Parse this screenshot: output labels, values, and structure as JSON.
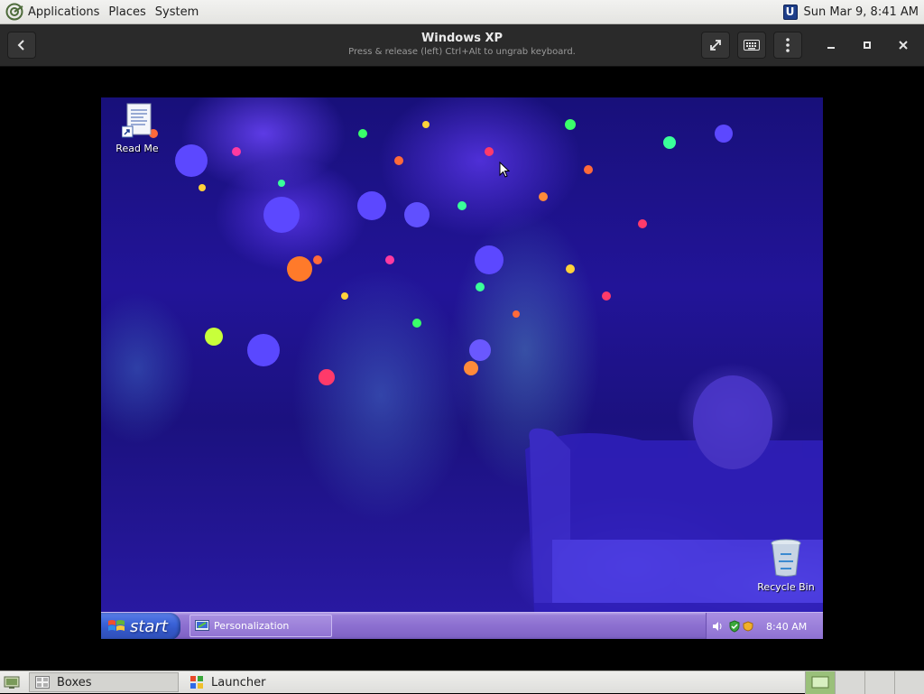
{
  "top_panel": {
    "menus": [
      "Applications",
      "Places",
      "System"
    ],
    "datetime": "Sun Mar  9,  8:41 AM",
    "tray_icon": "U"
  },
  "boxes": {
    "title": "Windows XP",
    "subtitle": "Press & release (left) Ctrl+Alt to ungrab keyboard.",
    "buttons": {
      "back": "back-arrow-icon",
      "fullscreen": "fullscreen-icon",
      "keyboard": "keyboard-icon",
      "menu": "kebab-menu-icon",
      "minimize": "minimize-icon",
      "maximize": "maximize-icon",
      "close": "close-icon"
    }
  },
  "xp_desktop": {
    "icons": [
      {
        "label": "Read Me"
      },
      {
        "label": "Recycle Bin"
      }
    ],
    "taskbar": {
      "start_label": "start",
      "tasks": [
        {
          "label": "Personalization"
        }
      ],
      "clock": "8:40 AM"
    }
  },
  "bottom_panel": {
    "tasks": [
      {
        "label": "Boxes",
        "active": true
      },
      {
        "label": "Launcher",
        "active": false
      }
    ],
    "workspaces": 4,
    "active_workspace": 1
  },
  "colors": {
    "xp_taskbar": "#8c6fd0",
    "xp_start": "#3b63d8",
    "headerbar": "#2a2a2a",
    "panel": "#eeeeec"
  }
}
